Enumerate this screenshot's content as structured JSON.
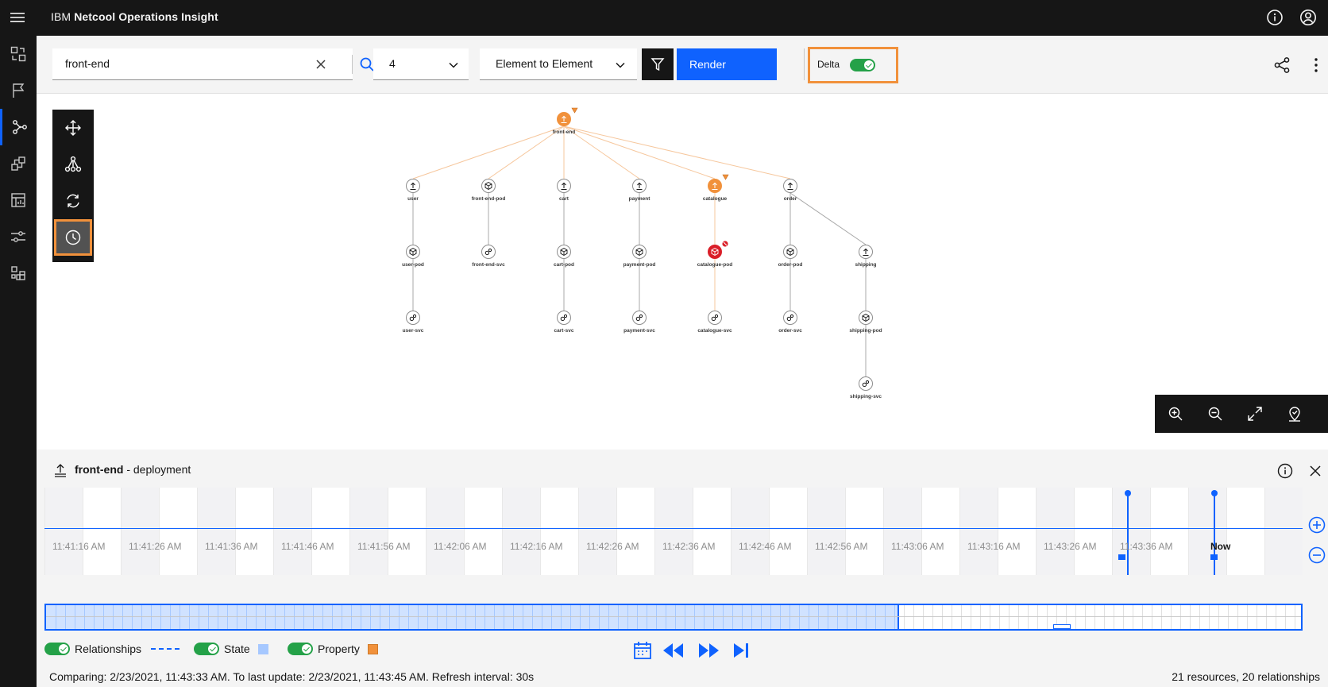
{
  "app": {
    "title_prefix": "IBM",
    "title_product": "Netcool Operations Insight"
  },
  "toolbar": {
    "search_value": "front-end",
    "hops_value": "4",
    "hop_type_value": "Element to Element",
    "render_label": "Render",
    "delta_label": "Delta",
    "delta_on": true
  },
  "graph": {
    "nodes": [
      {
        "id": "front-end",
        "label": "front-end",
        "type": "deployment",
        "status": "warning"
      },
      {
        "id": "user",
        "label": "user",
        "type": "deployment",
        "status": "normal"
      },
      {
        "id": "front-end-pod",
        "label": "front-end-pod",
        "type": "pod",
        "status": "normal"
      },
      {
        "id": "cart",
        "label": "cart",
        "type": "deployment",
        "status": "normal"
      },
      {
        "id": "payment",
        "label": "payment",
        "type": "deployment",
        "status": "normal"
      },
      {
        "id": "catalogue",
        "label": "catalogue",
        "type": "deployment",
        "status": "warning"
      },
      {
        "id": "order",
        "label": "order",
        "type": "deployment",
        "status": "normal"
      },
      {
        "id": "user-pod",
        "label": "user-pod",
        "type": "pod",
        "status": "normal"
      },
      {
        "id": "front-end-svc",
        "label": "front-end-svc",
        "type": "service",
        "status": "normal"
      },
      {
        "id": "cart-pod",
        "label": "cart-pod",
        "type": "pod",
        "status": "normal"
      },
      {
        "id": "payment-pod",
        "label": "payment-pod",
        "type": "pod",
        "status": "normal"
      },
      {
        "id": "catalogue-pod",
        "label": "catalogue-pod",
        "type": "pod",
        "status": "critical"
      },
      {
        "id": "order-pod",
        "label": "order-pod",
        "type": "pod",
        "status": "normal"
      },
      {
        "id": "shipping",
        "label": "shipping",
        "type": "deployment",
        "status": "normal"
      },
      {
        "id": "user-svc",
        "label": "user-svc",
        "type": "service",
        "status": "normal"
      },
      {
        "id": "cart-svc",
        "label": "cart-svc",
        "type": "service",
        "status": "normal"
      },
      {
        "id": "payment-svc",
        "label": "payment-svc",
        "type": "service",
        "status": "normal"
      },
      {
        "id": "catalogue-svc",
        "label": "catalogue-svc",
        "type": "service",
        "status": "normal"
      },
      {
        "id": "order-svc",
        "label": "order-svc",
        "type": "service",
        "status": "normal"
      },
      {
        "id": "shipping-pod",
        "label": "shipping-pod",
        "type": "pod",
        "status": "normal"
      },
      {
        "id": "shipping-svc",
        "label": "shipping-svc",
        "type": "service",
        "status": "normal"
      }
    ],
    "edges": [
      [
        "front-end",
        "user"
      ],
      [
        "front-end",
        "front-end-pod"
      ],
      [
        "front-end",
        "cart"
      ],
      [
        "front-end",
        "payment"
      ],
      [
        "front-end",
        "catalogue"
      ],
      [
        "front-end",
        "order"
      ],
      [
        "user",
        "user-pod"
      ],
      [
        "front-end-pod",
        "front-end-svc"
      ],
      [
        "cart",
        "cart-pod"
      ],
      [
        "payment",
        "payment-pod"
      ],
      [
        "catalogue",
        "catalogue-pod"
      ],
      [
        "order",
        "order-pod"
      ],
      [
        "order",
        "shipping"
      ],
      [
        "user-pod",
        "user-svc"
      ],
      [
        "cart-pod",
        "cart-svc"
      ],
      [
        "payment-pod",
        "payment-svc"
      ],
      [
        "catalogue-pod",
        "catalogue-svc"
      ],
      [
        "order-pod",
        "order-svc"
      ],
      [
        "shipping",
        "shipping-pod"
      ],
      [
        "shipping-pod",
        "shipping-svc"
      ]
    ]
  },
  "details": {
    "resource_name": "front-end",
    "resource_type": "- deployment",
    "tick_labels": [
      "11:41:16 AM",
      "11:41:26 AM",
      "11:41:36 AM",
      "11:41:46 AM",
      "11:41:56 AM",
      "11:42:06 AM",
      "11:42:16 AM",
      "11:42:26 AM",
      "11:42:36 AM",
      "11:42:46 AM",
      "11:42:56 AM",
      "11:43:06 AM",
      "11:43:16 AM",
      "11:43:26 AM",
      "11:43:36 AM",
      "Now"
    ],
    "legend": {
      "relationships": "Relationships",
      "state": "State",
      "property": "Property"
    },
    "status_left": "Comparing: 2/23/2021, 11:43:33 AM. To last update: 2/23/2021, 11:43:45 AM. Refresh interval: 30s",
    "status_right": "21 resources, 20 relationships"
  },
  "colors": {
    "accent": "#0f62fe",
    "highlight": "#f1913b",
    "warning": "#f1913b",
    "critical": "#da1e28",
    "toggle_on": "#24a148",
    "state_swatch": "#a6c8ff",
    "property_swatch": "#f1913b"
  }
}
